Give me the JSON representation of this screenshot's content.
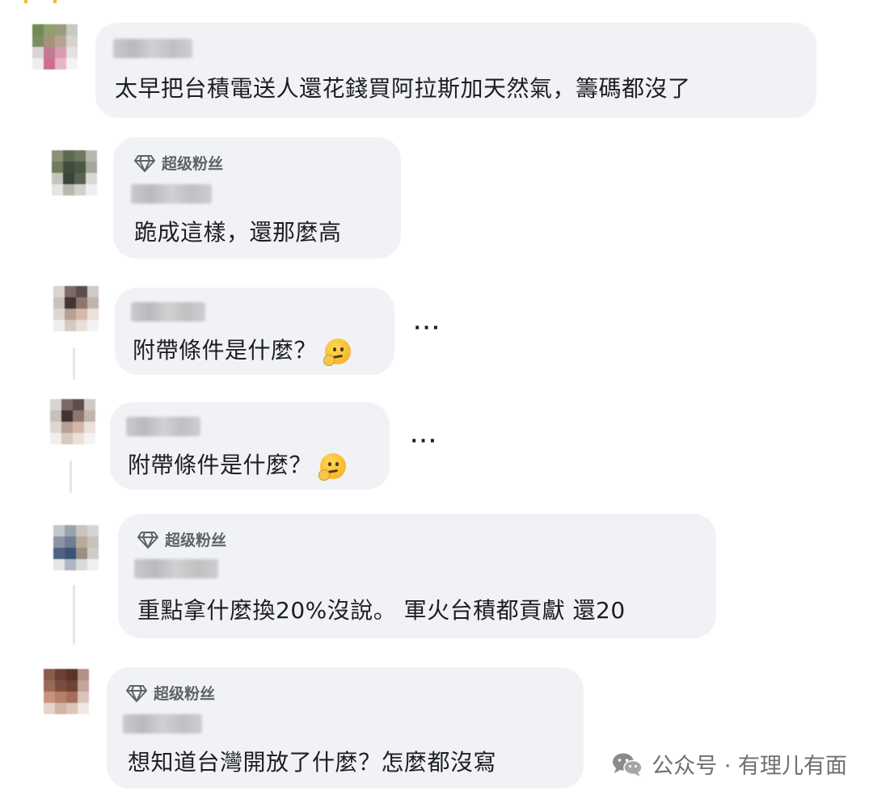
{
  "colors": {
    "bubble_bg": "#f0f2f5",
    "text": "#1c1e21",
    "badge_text": "#5e6167",
    "accent_corner": "#f2b632",
    "watermark_text": "#6f6f6f"
  },
  "comments": [
    {
      "badge": "",
      "text": "太早把台積電送人還花錢買阿拉斯加天然氣，籌碼都沒了",
      "has_emoji": false,
      "has_more": false
    },
    {
      "badge": "超级粉丝",
      "badge_icon": "diamond-icon",
      "text": "跪成這樣，還那麼高",
      "has_emoji": false,
      "has_more": false
    },
    {
      "badge": "",
      "text": "附帶條件是什麼？",
      "emoji": "thinking-face-emoji",
      "has_more": true,
      "more_label": "···"
    },
    {
      "badge": "",
      "text": "附帶條件是什麼？",
      "emoji": "thinking-face-emoji",
      "has_more": true,
      "more_label": "···"
    },
    {
      "badge": "超级粉丝",
      "badge_icon": "diamond-icon",
      "text": "重點拿什麼換20%沒說。 軍火台積都貢獻 還20",
      "has_emoji": false,
      "has_more": false
    },
    {
      "badge": "超级粉丝",
      "badge_icon": "diamond-icon",
      "text": "想知道台灣開放了什麼？怎麼都沒寫",
      "has_emoji": false,
      "has_more": false
    }
  ],
  "watermark": {
    "icon": "wechat-icon",
    "text": "公众号 · 有理儿有面"
  }
}
